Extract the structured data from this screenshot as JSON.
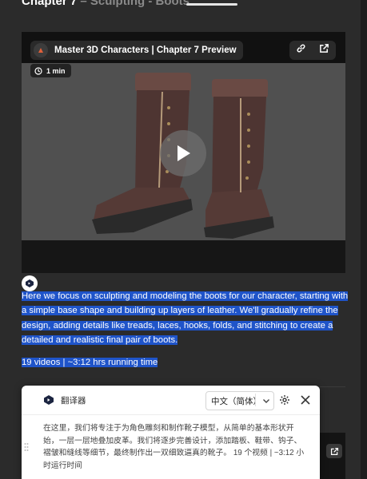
{
  "header": {
    "chapter": "Chapter 7",
    "subtitle": "– Sculpting - Boots"
  },
  "video": {
    "title": "Master 3D Characters | Chapter 7 Preview",
    "duration": "1 min",
    "icons": [
      "video-channel-avatar",
      "link-icon",
      "external-link-icon",
      "clock-icon",
      "play-icon"
    ]
  },
  "description": {
    "text": "Here we focus on sculpting and modeling the boots for our character, starting with a simple base shape and building up layers of leather. We'll gradually refine the design, adding details like treads, laces, hooks, folds, and stitching to create a detailed and realistic final pair of boots.",
    "meta": "19 videos | ~3:12 hrs running time"
  },
  "translator": {
    "title": "翻译器",
    "language": "中文（简体）",
    "text": "在这里，我们将专注于为角色雕刻和制作靴子模型，从简单的基本形状开始，一层一层地叠加皮革。我们将逐步完善设计，添加踏板、鞋带、钩子、褶皱和缝线等细节，最终制作出一双细致逼真的靴子。 19 个视频 | ~3:12 小时运行时间"
  },
  "colors": {
    "page_bg": "#2b2b2b",
    "selection": "#1f54c9",
    "video_bg": "#505050"
  }
}
